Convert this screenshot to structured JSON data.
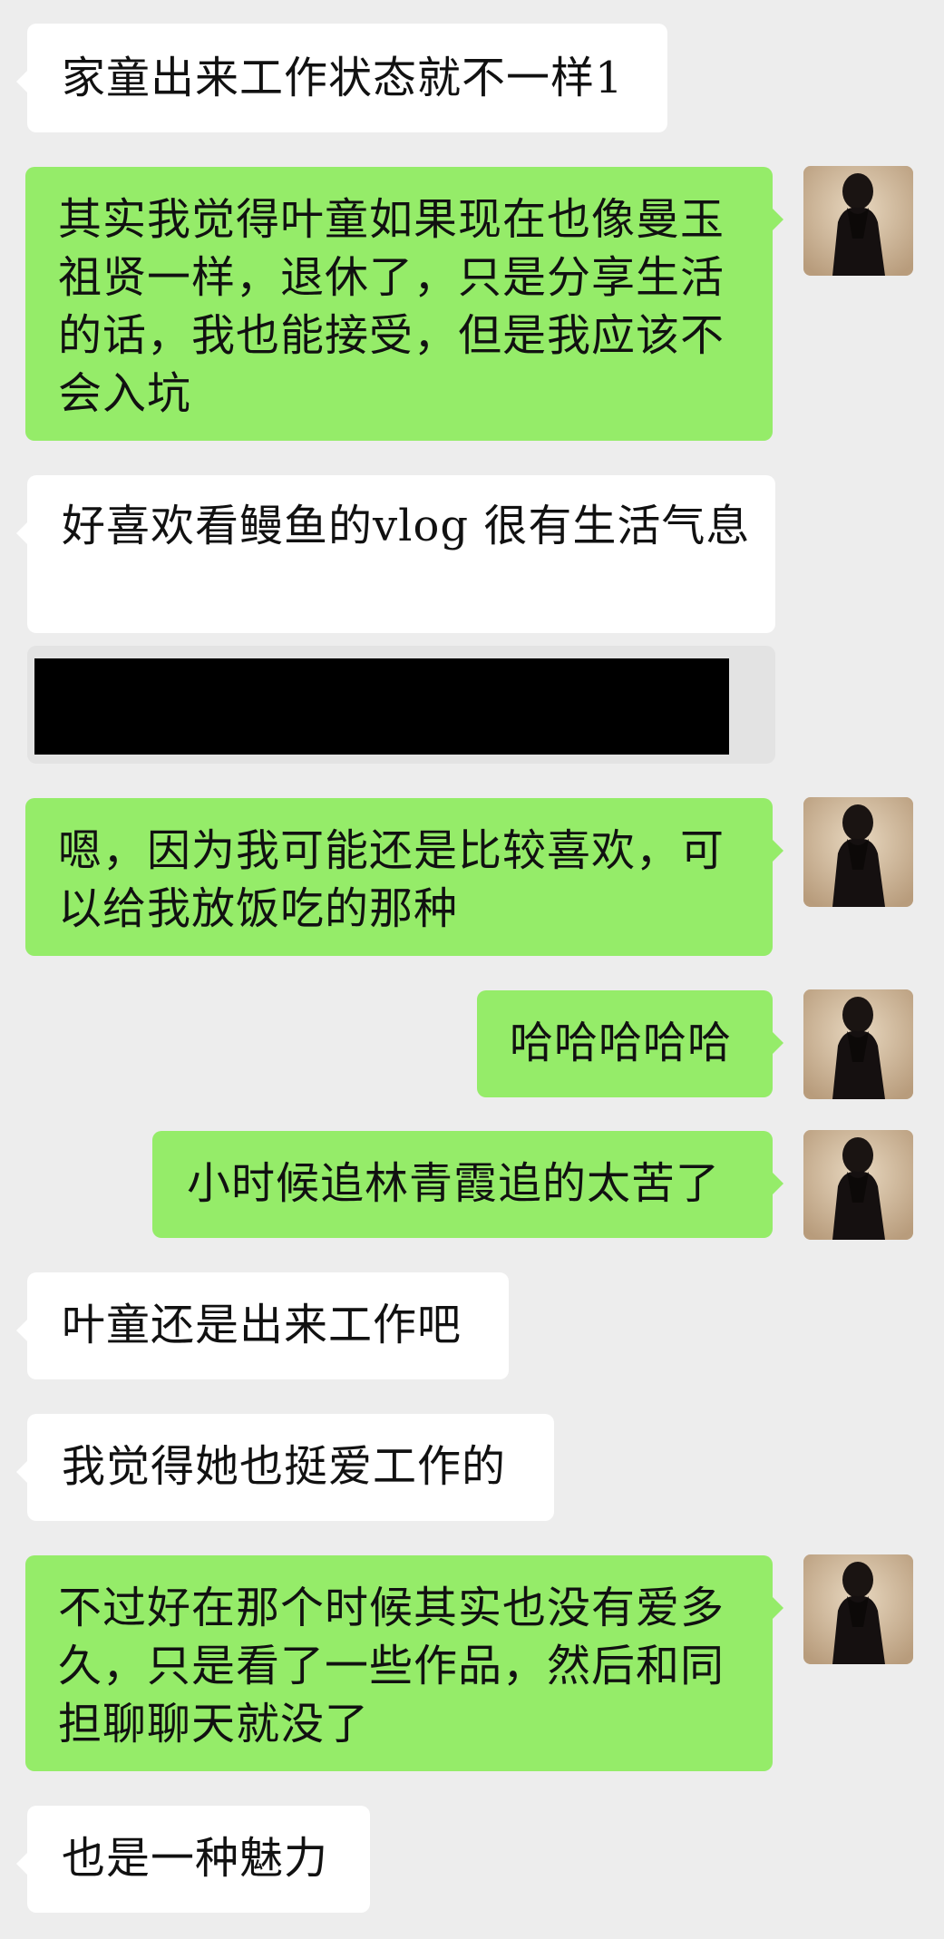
{
  "messages": [
    {
      "side": "in",
      "text": "家童出来工作状态就不一样1"
    },
    {
      "side": "out",
      "text": "其实我觉得叶童如果现在也像曼玉祖贤一样，退休了，只是分享生活的话，我也能接受，但是我应该不会入坑"
    },
    {
      "side": "in",
      "text": "好喜欢看鳗鱼的vlog  很有生活气息"
    },
    {
      "side": "in",
      "text": "",
      "redacted": true
    },
    {
      "side": "out",
      "text": "嗯，因为我可能还是比较喜欢，可以给我放饭吃的那种"
    },
    {
      "side": "out",
      "text": "哈哈哈哈哈"
    },
    {
      "side": "out",
      "text": "小时候追林青霞追的太苦了"
    },
    {
      "side": "in",
      "text": "叶童还是出来工作吧"
    },
    {
      "side": "in",
      "text": "我觉得她也挺爱工作的"
    },
    {
      "side": "out",
      "text": "不过好在那个时候其实也没有爱多久，只是看了一些作品，然后和同担聊聊天就没了"
    },
    {
      "side": "in",
      "text": "也是一种魅力"
    }
  ],
  "colors": {
    "background": "#ededed",
    "incoming_bubble": "#ffffff",
    "outgoing_bubble": "#95ec69",
    "text": "#111111"
  },
  "avatar": {
    "icon": "user-avatar-dark-figure"
  }
}
